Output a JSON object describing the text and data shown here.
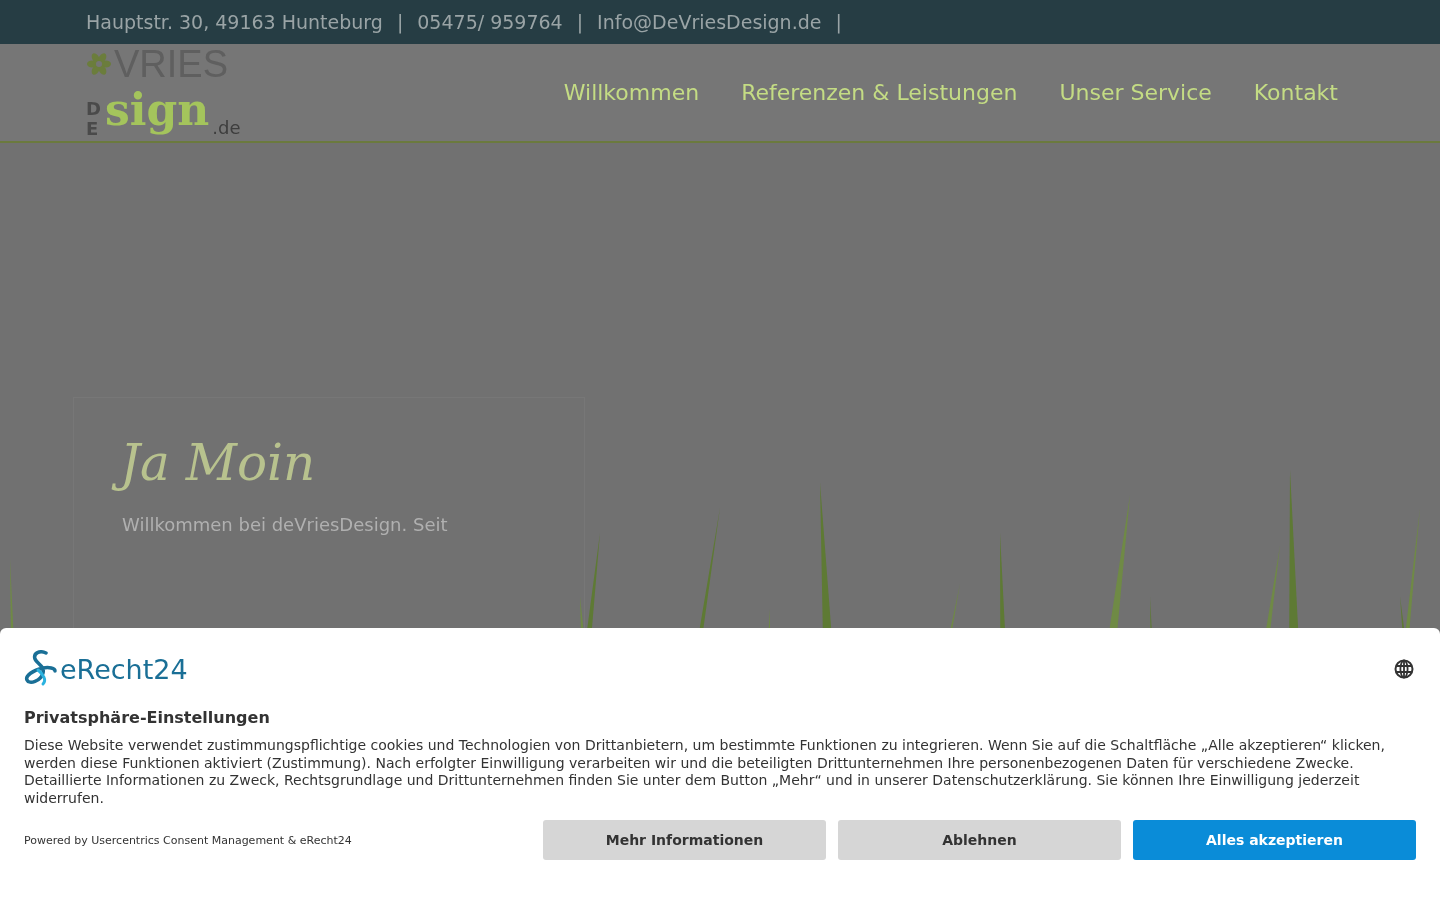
{
  "topbar": {
    "items": [
      "Hauptstr. 30, 49163 Hunteburg",
      "05475/ 959764",
      "Info@DeVriesDesign.de"
    ],
    "separator": "|"
  },
  "logo": {
    "top": "VRIES",
    "side": "DE",
    "main": "sign",
    "suffix": ".de"
  },
  "nav": [
    {
      "label": "Willkommen"
    },
    {
      "label": "Referenzen & Leistungen"
    },
    {
      "label": "Unser Service"
    },
    {
      "label": "Kontakt"
    }
  ],
  "intro": {
    "heading": "Ja Moin",
    "text": "Willkommen bei deVriesDesign. Seit"
  },
  "consent": {
    "brand": "eRecht24",
    "title": "Privatsphäre-Einstellungen",
    "text": "Diese Website verwendet zustimmungspflichtige cookies und Technologien von Drittanbietern, um bestimmte Funktionen zu integrieren. Wenn Sie auf die Schaltfläche „Alle akzeptieren“ klicken, werden diese Funktionen aktiviert (Zustimmung). Nach erfolgter Einwilligung verarbeiten wir und die beteiligten Drittunternehmen Ihre personenbezogenen Daten für verschiedene Zwecke. Detaillierte Informationen zu Zweck, Rechtsgrundlage und Drittunternehmen finden Sie unter dem Button „Mehr“ und in unserer Datenschutzerklärung. Sie können Ihre Einwilligung jederzeit widerrufen.",
    "powered": "Powered by Usercentrics Consent Management & eRecht24",
    "buttons": [
      {
        "label": "Mehr Informationen",
        "kind": "secondary"
      },
      {
        "label": "Ablehnen",
        "kind": "secondary"
      },
      {
        "label": "Alles akzeptieren",
        "kind": "primary"
      }
    ]
  }
}
